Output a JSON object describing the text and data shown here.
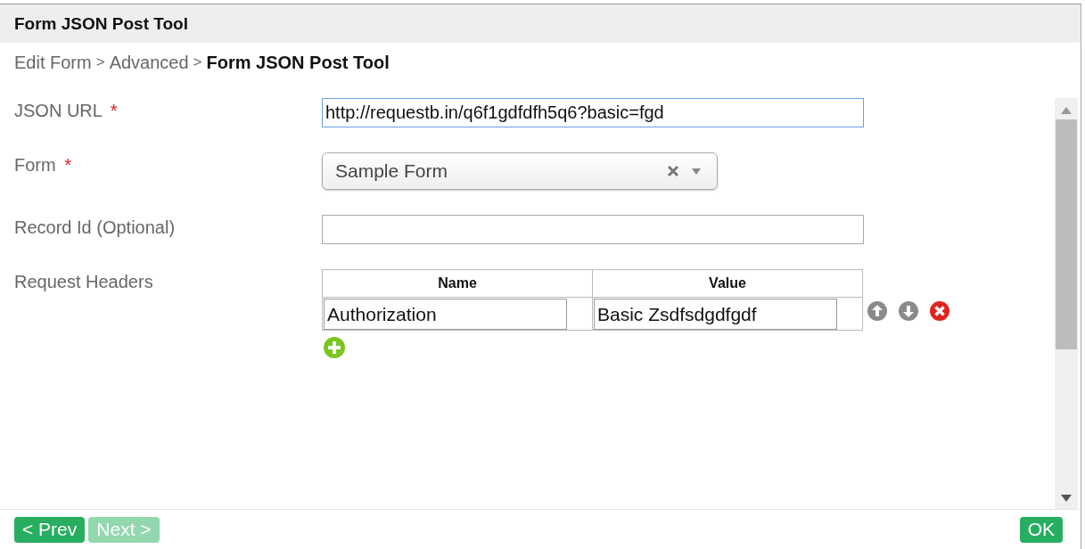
{
  "dialog": {
    "title": "Form JSON Post Tool"
  },
  "breadcrumb": [
    {
      "label": "Edit Form",
      "current": false
    },
    {
      "label": "Advanced",
      "current": false
    },
    {
      "label": "Form JSON Post Tool",
      "current": true
    }
  ],
  "separator": ">",
  "required_mark": "*",
  "fields": [
    {
      "kind": "text",
      "label": "JSON URL",
      "required": true,
      "value": "http://requestb.in/q6f1gdfdfh5q6?basic=fgd",
      "focused": true
    },
    {
      "kind": "select",
      "label": "Form",
      "required": true,
      "value": "Sample Form",
      "focused": false
    },
    {
      "kind": "text",
      "label": "Record Id (Optional)",
      "required": false,
      "focused": false
    },
    {
      "kind": "grid",
      "label": "Request Headers",
      "required": false,
      "columns": [
        "Name",
        "Value"
      ],
      "rows": [
        [
          "Authorization",
          "Basic Zsdfsdgdfgdf"
        ]
      ]
    }
  ],
  "footer": {
    "left_buttons": [
      {
        "label": "< Prev",
        "disabled": false
      },
      {
        "label": "Next >",
        "disabled": true
      }
    ],
    "right_buttons": [
      {
        "label": "OK",
        "disabled": false
      }
    ]
  }
}
